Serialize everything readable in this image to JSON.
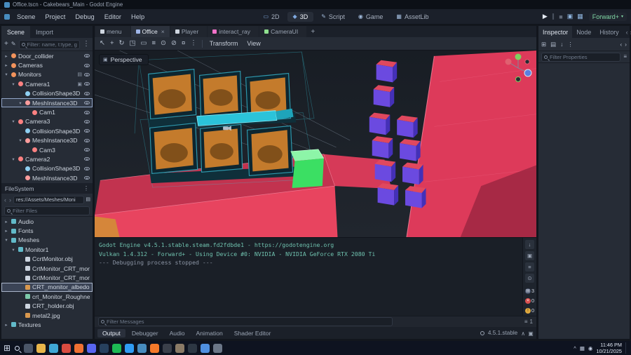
{
  "window": {
    "title": "Office.tscn - Cakebears_Main - Godot Engine"
  },
  "colors": {
    "accent": "#699ce8",
    "scene_red": "#e8445f",
    "screen_orange": "#c47b2c",
    "cube_purple": "#6b4ae0",
    "cube_top_pink": "#e0485e",
    "selection_teal": "#2cc6da",
    "green_cube": "#3bdf63",
    "renderer_green": "#7fd6a4"
  },
  "menubar": {
    "menus": [
      {
        "label": "Scene",
        "name": "menu-scene"
      },
      {
        "label": "Project",
        "name": "menu-project"
      },
      {
        "label": "Debug",
        "name": "menu-debug"
      },
      {
        "label": "Editor",
        "name": "menu-editor"
      },
      {
        "label": "Help",
        "name": "menu-help"
      }
    ],
    "workspaces": [
      {
        "glyph": "▭",
        "icon_color": "#7fa9e0",
        "label": "2D",
        "name": "workspace-2d"
      },
      {
        "glyph": "◆",
        "icon_color": "#7fa9e0",
        "label": "3D",
        "state": "active",
        "name": "workspace-3d"
      },
      {
        "glyph": "✎",
        "icon_color": "#9fb8d8",
        "label": "Script",
        "name": "workspace-script"
      },
      {
        "glyph": "◉",
        "icon_color": "#9fb8d8",
        "label": "Game",
        "name": "workspace-game"
      },
      {
        "glyph": "▦",
        "icon_color": "#9fb8d8",
        "label": "AssetLib",
        "name": "workspace-assetlib"
      }
    ],
    "playback": [
      {
        "glyph": "▶",
        "color": "#e6ecf5",
        "name": "play-button"
      },
      {
        "glyph": "∥",
        "color": "#5f6877",
        "name": "pause-button"
      },
      {
        "glyph": "■",
        "color": "#5f6877",
        "name": "stop-button"
      },
      {
        "glyph": "▣",
        "color": "#8fb5de",
        "name": "remote-debug-button"
      },
      {
        "glyph": "▦",
        "color": "#8fb5de",
        "name": "movie-mode-button"
      }
    ],
    "renderer": {
      "label": "Forward+",
      "caret": "▾"
    }
  },
  "scene_dock": {
    "tabs": [
      {
        "label": "Scene",
        "state": "active",
        "name": "tab-scene"
      },
      {
        "label": "Import",
        "name": "tab-import"
      }
    ],
    "add_glyph": "+",
    "script_glyph": "✎",
    "menu_glyph": "⋮",
    "filter_placeholder": "Filter: name, t:type, g",
    "tree": [
      {
        "arrow": "▸",
        "icon_color": "#f2935c",
        "label": "Door_collider",
        "indent": 0
      },
      {
        "arrow": "▸",
        "icon_color": "#f2935c",
        "label": "Cameras",
        "indent": 0
      },
      {
        "arrow": "▾",
        "icon_color": "#f2935c",
        "label": "Monitors",
        "indent": 0,
        "extra": "▤"
      },
      {
        "arrow": "▾",
        "icon_color": "#fc8181",
        "label": "Camera1",
        "indent": 1,
        "extra": "▣"
      },
      {
        "arrow": "",
        "icon_color": "#8fd0f2",
        "label": "CollisionShape3D",
        "indent": 2
      },
      {
        "arrow": "▾",
        "icon_color": "#fc9d9d",
        "label": "MeshInstance3D",
        "indent": 2,
        "state": "focused"
      },
      {
        "arrow": "",
        "icon_color": "#fc8181",
        "label": "Cam1",
        "indent": 3
      },
      {
        "arrow": "▾",
        "icon_color": "#fc8181",
        "label": "Camera3",
        "indent": 1
      },
      {
        "arrow": "",
        "icon_color": "#8fd0f2",
        "label": "CollisionShape3D",
        "indent": 2
      },
      {
        "arrow": "▾",
        "icon_color": "#fc9d9d",
        "label": "MeshInstance3D",
        "indent": 2
      },
      {
        "arrow": "",
        "icon_color": "#fc8181",
        "label": "Cam3",
        "indent": 3
      },
      {
        "arrow": "▾",
        "icon_color": "#fc8181",
        "label": "Camera2",
        "indent": 1
      },
      {
        "arrow": "",
        "icon_color": "#8fd0f2",
        "label": "CollisionShape3D",
        "indent": 2
      },
      {
        "arrow": "",
        "icon_color": "#fc9d9d",
        "label": "MeshInstance3D",
        "indent": 2
      }
    ]
  },
  "filesystem": {
    "title": "FileSystem",
    "menu_glyph": "⋮",
    "nav_back": "‹",
    "nav_fwd": "›",
    "path": "res://Assets/Meshes/Moni",
    "split_glyph": "▤",
    "filter_placeholder": "Filter Files",
    "tree": [
      {
        "arrow": "▸",
        "icon_color": "#62bac9",
        "label": "Audio",
        "indent": 0
      },
      {
        "arrow": "▸",
        "icon_color": "#62bac9",
        "label": "Fonts",
        "indent": 0
      },
      {
        "arrow": "▾",
        "icon_color": "#62bac9",
        "label": "Meshes",
        "indent": 0
      },
      {
        "arrow": "▾",
        "icon_color": "#62bac9",
        "label": "Monitor1",
        "indent": 1
      },
      {
        "arrow": "",
        "icon_color": "#cdd5e0",
        "label": "CcrtMonitor.obj",
        "indent": 2
      },
      {
        "arrow": "",
        "icon_color": "#cdd5e0",
        "label": "CrtMonitor_CRT_moni...",
        "indent": 2
      },
      {
        "arrow": "",
        "icon_color": "#cdd5e0",
        "label": "CrtMonitor_CRT_moni...",
        "indent": 2
      },
      {
        "arrow": "",
        "icon_color": "#d9984e",
        "label": "CRT_monitor_albedo...",
        "indent": 2,
        "state": "selected"
      },
      {
        "arrow": "",
        "icon_color": "#7cc9a9",
        "label": "crt_Monitor_Roughne...",
        "indent": 2
      },
      {
        "arrow": "",
        "icon_color": "#cdd5e0",
        "label": "CRT_holder.obj",
        "indent": 2
      },
      {
        "arrow": "",
        "icon_color": "#d9984e",
        "label": "metal2.jpg",
        "indent": 2
      },
      {
        "arrow": "▸",
        "icon_color": "#62bac9",
        "label": "Textures",
        "indent": 0
      }
    ]
  },
  "scene_tabs": {
    "items": [
      {
        "dot": "#cfd6e0",
        "label": "menu",
        "name": "scene-tab-menu"
      },
      {
        "dot": "#9fb6e8",
        "label": "Office",
        "close": "×",
        "state": "active",
        "name": "scene-tab-office"
      },
      {
        "dot": "#cfd6e0",
        "label": "Player",
        "name": "scene-tab-player"
      },
      {
        "dot": "#f272c8",
        "label": "interact_ray",
        "name": "scene-tab-interact-ray"
      },
      {
        "dot": "#8fe08f",
        "label": "CameraUI",
        "name": "scene-tab-cameraui"
      }
    ],
    "add_label": "+"
  },
  "viewport": {
    "tools": [
      {
        "glyph": "↖",
        "name": "select-tool"
      },
      {
        "glyph": "+",
        "name": "move-tool"
      },
      {
        "glyph": "↻",
        "name": "rotate-tool"
      },
      {
        "glyph": "◳",
        "name": "scale-tool"
      },
      {
        "glyph": "▭",
        "name": "box-select-tool"
      },
      {
        "glyph": "≡",
        "name": "list-select-tool"
      },
      {
        "glyph": "⊙",
        "name": "lock-tool"
      },
      {
        "glyph": "⊘",
        "name": "unlock-tool"
      },
      {
        "glyph": "¤",
        "name": "snap-tool"
      },
      {
        "glyph": "⋮",
        "name": "extra-tools-menu"
      }
    ],
    "transform_label": "Transform",
    "view_label": "View",
    "perspective_label": "Perspective"
  },
  "output": {
    "lines": [
      {
        "text": "Godot Engine v4.5.1.stable.steam.fd2fdbde1 - https://godotengine.org",
        "color": "#6fc1ae"
      },
      {
        "text": "Vulkan 1.4.312 - Forward+ - Using Device #0: NVIDIA - NVIDIA GeForce RTX 2080 Ti",
        "color": "#6fc1ae"
      },
      {
        "text": "--- Debugging process stopped ---",
        "color": "#8a93a3"
      }
    ],
    "side_buttons": [
      {
        "glyph": "↓",
        "name": "scroll-to-bottom-button"
      },
      {
        "glyph": "▣",
        "name": "copy-log-button"
      },
      {
        "glyph": "≡",
        "name": "toggle-wrap-button"
      },
      {
        "glyph": "⊙",
        "name": "search-log-button"
      }
    ],
    "badges": [
      {
        "bg": "#47536b",
        "glyph": "▤",
        "fg": "#e8eef8",
        "count": "3",
        "name": "messages-count-badge"
      },
      {
        "bg": "#d8504f",
        "glyph": "×",
        "fg": "#ffffff",
        "count": "0",
        "name": "errors-count-badge"
      },
      {
        "bg": "#e0a93e",
        "glyph": "!",
        "fg": "#3a2d10",
        "count": "0",
        "name": "warnings-count-badge"
      }
    ]
  },
  "bottom": {
    "filter_placeholder": "Filter Messages",
    "filter_glyph": "≡",
    "filter_count": "1",
    "tabs": [
      {
        "label": "Output",
        "state": "active",
        "name": "tab-output"
      },
      {
        "label": "Debugger",
        "name": "tab-debugger"
      },
      {
        "label": "Audio",
        "name": "tab-audio"
      },
      {
        "label": "Animation",
        "name": "tab-animation"
      },
      {
        "label": "Shader Editor",
        "name": "tab-shader-editor"
      }
    ],
    "version": "4.5.1.stable",
    "right_icons": [
      {
        "glyph": "∧",
        "name": "collapse-bottom-panel-icon"
      },
      {
        "glyph": "▣",
        "name": "pin-bottom-panel-icon"
      }
    ]
  },
  "inspector": {
    "tabs": [
      {
        "label": "Inspector",
        "state": "active",
        "name": "tab-inspector"
      },
      {
        "label": "Node",
        "name": "tab-node"
      },
      {
        "label": "History",
        "name": "tab-history"
      }
    ],
    "nav_back": "‹",
    "nav_fwd": "›",
    "toolbar": [
      {
        "glyph": "⊞",
        "name": "new-resource-button"
      },
      {
        "glyph": "▤",
        "name": "load-resource-button"
      },
      {
        "glyph": "↓",
        "name": "save-resource-button"
      },
      {
        "glyph": "⋮",
        "name": "resource-menu-button"
      }
    ],
    "filter_placeholder": "Filter Properties",
    "filter_glyph": "≡"
  },
  "taskbar": {
    "apps": [
      {
        "name": "task-view-icon",
        "color": "#4a5568"
      },
      {
        "name": "file-explorer-icon",
        "color": "#e8b54a"
      },
      {
        "name": "edge-icon",
        "color": "#3fa7d6"
      },
      {
        "name": "chrome-icon",
        "color": "#d84b40"
      },
      {
        "name": "firefox-icon",
        "color": "#f07032"
      },
      {
        "name": "discord-icon",
        "color": "#5865f2"
      },
      {
        "name": "steam-icon",
        "color": "#27405e"
      },
      {
        "name": "spotify-icon",
        "color": "#1db954"
      },
      {
        "name": "vscode-icon",
        "color": "#2f9cf4"
      },
      {
        "name": "godot-icon",
        "color": "#478cbf"
      },
      {
        "name": "blender-icon",
        "color": "#f5792a"
      },
      {
        "name": "obs-icon",
        "color": "#3a3f4a"
      },
      {
        "name": "gimp-icon",
        "color": "#8a7a66"
      },
      {
        "name": "terminal-icon",
        "color": "#2d3743"
      },
      {
        "name": "mail-icon",
        "color": "#4f8fe0"
      },
      {
        "name": "settings-icon",
        "color": "#6b7687"
      }
    ],
    "tray": [
      {
        "glyph": "^",
        "name": "tray-expand-icon"
      },
      {
        "glyph": "▦",
        "name": "network-icon"
      },
      {
        "glyph": "◉",
        "name": "volume-icon"
      }
    ],
    "clock": {
      "time": "11:46 PM",
      "date": "10/21/2025"
    }
  }
}
